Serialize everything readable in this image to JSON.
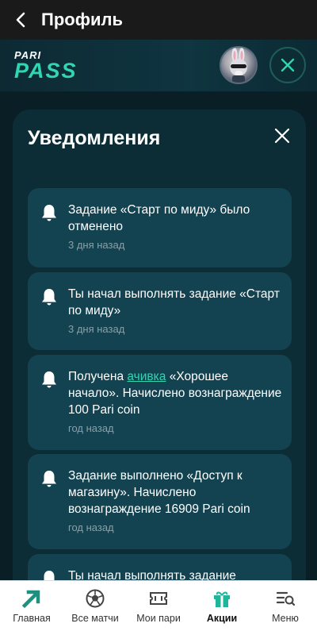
{
  "topbar": {
    "title": "Профиль"
  },
  "brand": {
    "logo_top": "PARI",
    "logo_bottom": "PASS"
  },
  "notifications": {
    "title": "Уведомления",
    "items": [
      {
        "text": "Задание «Старт по миду» было отменено",
        "time": "3 дня назад"
      },
      {
        "text": "Ты начал выполнять задание «Старт по миду»",
        "time": "3 дня назад"
      },
      {
        "text_before": "Получена ",
        "link": "ачивка",
        "text_after": " «Хорошее начало». Начислено вознаграждение 100 Pari coin",
        "time": "год назад"
      },
      {
        "text": "Задание выполнено «Доступ к магазину». Начислено вознаграждение 16909 Pari coin",
        "time": "год назад"
      },
      {
        "text": "Ты начал выполнять задание"
      }
    ]
  },
  "bottom_nav": [
    {
      "label": "Главная",
      "icon": "home-arrow-icon"
    },
    {
      "label": "Все матчи",
      "icon": "soccer-ball-icon"
    },
    {
      "label": "Мои пари",
      "icon": "ticket-icon"
    },
    {
      "label": "Акции",
      "icon": "gift-icon",
      "active": true
    },
    {
      "label": "Меню",
      "icon": "menu-search-icon"
    }
  ],
  "colors": {
    "accent": "#2fd6b0",
    "panel": "#0d2d36",
    "card": "#134250",
    "background": "#0a1f25"
  }
}
